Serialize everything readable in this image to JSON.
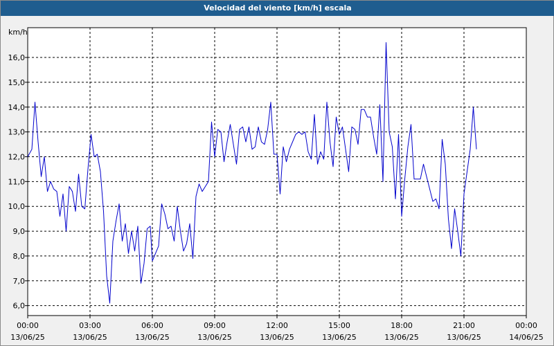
{
  "window": {
    "title": "Velocidad del viento [km/h] escala"
  },
  "chart_data": {
    "type": "line",
    "title": "Velocidad del viento [km/h] escala",
    "unit_label": "km/h",
    "ylim": [
      5.6,
      17.2
    ],
    "y_ticks": [
      "6,0",
      "7,0",
      "8,0",
      "9,0",
      "10,0",
      "11,0",
      "12,0",
      "13,0",
      "14,0",
      "15,0",
      "16,0"
    ],
    "x_ticks": [
      {
        "time": "00:00",
        "date": "13/06/25"
      },
      {
        "time": "03:00",
        "date": "13/06/25"
      },
      {
        "time": "06:00",
        "date": "13/06/25"
      },
      {
        "time": "09:00",
        "date": "13/06/25"
      },
      {
        "time": "12:00",
        "date": "13/06/25"
      },
      {
        "time": "15:00",
        "date": "13/06/25"
      },
      {
        "time": "18:00",
        "date": "13/06/25"
      },
      {
        "time": "21:00",
        "date": "13/06/25"
      },
      {
        "time": "00:00",
        "date": "14/06/25"
      }
    ],
    "grid": true,
    "line_color": "#0000cc",
    "series": [
      {
        "x_hours": [
          0.0,
          0.2,
          0.35,
          0.5,
          0.65,
          0.8,
          0.95,
          1.1,
          1.25,
          1.4,
          1.55,
          1.7,
          1.85,
          2.0,
          2.15,
          2.3,
          2.45,
          2.6,
          2.75,
          2.9,
          3.05,
          3.2,
          3.35,
          3.5,
          3.65,
          3.8,
          3.95,
          4.1,
          4.25,
          4.4,
          4.55,
          4.7,
          4.85,
          5.0,
          5.15,
          5.3,
          5.45,
          5.6,
          5.75,
          5.9,
          6.0,
          6.15,
          6.3,
          6.45,
          6.6,
          6.75,
          6.9,
          7.05,
          7.2,
          7.35,
          7.5,
          7.65,
          7.8,
          7.95,
          8.1,
          8.25,
          8.4,
          8.55,
          8.7,
          8.85,
          9.0,
          9.15,
          9.3,
          9.45,
          9.6,
          9.75,
          9.9,
          10.05,
          10.2,
          10.35,
          10.5,
          10.65,
          10.8,
          10.95,
          11.1,
          11.25,
          11.4,
          11.55,
          11.7,
          11.85,
          12.0,
          12.15,
          12.3,
          12.45,
          12.6,
          12.75,
          12.9,
          13.05,
          13.2,
          13.35,
          13.5,
          13.65,
          13.8,
          13.95,
          14.1,
          14.25,
          14.4,
          14.55,
          14.7,
          14.85,
          15.0,
          15.15,
          15.3,
          15.45,
          15.6,
          15.75,
          15.9,
          16.05,
          16.2,
          16.35,
          16.5,
          16.65,
          16.8,
          16.95,
          17.1,
          17.25,
          17.4,
          17.55,
          17.7,
          17.85,
          18.0,
          18.15,
          18.3,
          18.45,
          18.6,
          18.75,
          18.9,
          19.05,
          19.2,
          19.35,
          19.5,
          19.65,
          19.8,
          19.95,
          20.1,
          20.25,
          20.4,
          20.55,
          20.7,
          20.85,
          21.0,
          21.15,
          21.3,
          21.45,
          21.6,
          21.75,
          21.9,
          22.05,
          22.2,
          22.35,
          22.5,
          22.65,
          22.8,
          22.95,
          23.1,
          23.25,
          23.4,
          23.55,
          23.7,
          23.85,
          24.0
        ],
        "values": [
          12.0,
          12.3,
          14.2,
          12.6,
          11.2,
          12.0,
          10.6,
          11.0,
          10.7,
          10.6,
          9.6,
          10.5,
          9.0,
          10.8,
          10.6,
          9.8,
          11.3,
          10.0,
          9.9,
          11.5,
          12.9,
          12.0,
          12.1,
          11.4,
          9.8,
          7.2,
          6.1,
          8.6,
          9.4,
          10.1,
          8.6,
          9.3,
          8.1,
          9.0,
          8.2,
          9.2,
          6.9,
          7.7,
          9.1,
          9.2,
          7.8,
          8.1,
          8.4,
          10.1,
          9.7,
          9.1,
          9.2,
          8.6,
          10.0,
          9.0,
          8.2,
          8.5,
          9.3,
          7.9,
          10.4,
          10.9,
          10.6,
          10.8,
          11.0,
          13.4,
          12.0,
          13.1,
          13.0,
          11.8,
          12.6,
          13.3,
          12.5,
          11.7,
          13.1,
          13.2,
          12.6,
          13.2,
          12.3,
          12.4,
          13.2,
          12.6,
          12.5,
          13.1,
          14.2,
          12.1,
          12.1,
          10.5,
          12.4,
          11.8,
          12.3,
          12.6,
          12.9,
          13.0,
          12.9,
          13.0,
          12.2,
          11.9,
          13.7,
          11.7,
          12.2,
          11.9,
          14.2,
          12.6,
          11.6,
          13.6,
          12.9,
          13.2,
          12.3,
          11.4,
          13.2,
          13.1,
          12.5,
          13.9,
          13.9,
          13.6,
          13.6,
          12.8,
          12.1,
          14.1,
          11.0,
          16.6,
          13.0,
          12.4,
          10.3,
          12.9,
          9.6,
          11.1,
          12.4,
          13.3,
          11.1,
          11.1,
          11.1,
          11.7,
          11.2,
          10.7,
          10.2,
          10.3,
          9.9,
          12.7,
          11.7,
          9.5,
          8.3,
          9.9,
          9.0,
          8.0,
          10.5,
          11.4,
          12.3,
          14.0,
          12.3
        ],
        "values_note_tail": ""
      }
    ]
  }
}
